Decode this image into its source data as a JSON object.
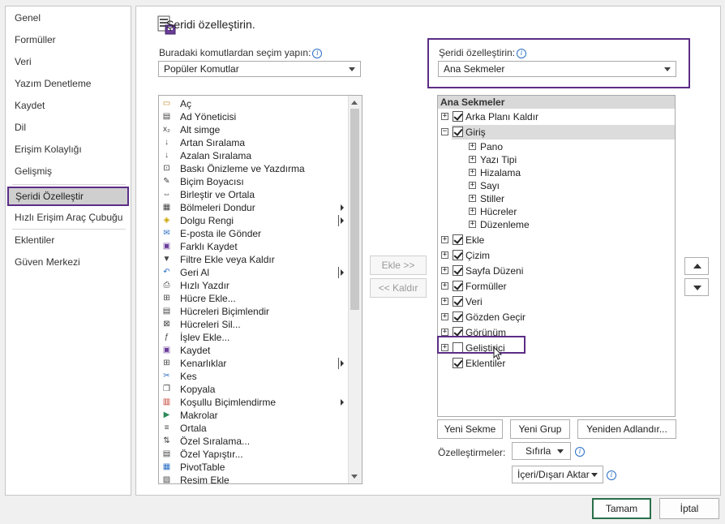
{
  "nav": {
    "items": [
      "Genel",
      "Formüller",
      "Veri",
      "Yazım Denetleme",
      "Kaydet",
      "Dil",
      "Erişim Kolaylığı",
      "Gelişmiş",
      "Şeridi Özelleştir",
      "Hızlı Erişim Araç Çubuğu",
      "Eklentiler",
      "Güven Merkezi"
    ],
    "selected": "Şeridi Özelleştir"
  },
  "header": {
    "title": "Şeridi özelleştirin."
  },
  "left_panel": {
    "label": "Buradaki komutlardan seçim yapın:",
    "dropdown_value": "Popüler Komutlar",
    "commands": [
      {
        "label": "Aç",
        "icon": "folder-icon",
        "submenu": false
      },
      {
        "label": "Ad Yöneticisi",
        "icon": "name-manager-icon",
        "submenu": false
      },
      {
        "label": "Alt simge",
        "icon": "subscript-icon",
        "submenu": false
      },
      {
        "label": "Artan Sıralama",
        "icon": "sort-ascending-icon",
        "submenu": false
      },
      {
        "label": "Azalan Sıralama",
        "icon": "sort-descending-icon",
        "submenu": false
      },
      {
        "label": "Baskı Önizleme ve Yazdırma",
        "icon": "print-preview-icon",
        "submenu": false
      },
      {
        "label": "Biçim Boyacısı",
        "icon": "format-painter-icon",
        "submenu": false
      },
      {
        "label": "Birleştir ve Ortala",
        "icon": "merge-center-icon",
        "submenu": false
      },
      {
        "label": "Bölmeleri Dondur",
        "icon": "freeze-panes-icon",
        "submenu": true,
        "separator": false
      },
      {
        "label": "Dolgu Rengi",
        "icon": "fill-color-icon",
        "submenu": true,
        "separator": true
      },
      {
        "label": "E-posta ile Gönder",
        "icon": "email-icon",
        "submenu": false
      },
      {
        "label": "Farklı Kaydet",
        "icon": "save-as-icon",
        "submenu": false
      },
      {
        "label": "Filtre Ekle veya Kaldır",
        "icon": "filter-icon",
        "submenu": false
      },
      {
        "label": "Geri Al",
        "icon": "undo-icon",
        "submenu": true,
        "separator": true
      },
      {
        "label": "Hızlı Yazdır",
        "icon": "quick-print-icon",
        "submenu": false
      },
      {
        "label": "Hücre Ekle...",
        "icon": "insert-cells-icon",
        "submenu": false
      },
      {
        "label": "Hücreleri Biçimlendir",
        "icon": "format-cells-icon",
        "submenu": false
      },
      {
        "label": "Hücreleri Sil...",
        "icon": "delete-cells-icon",
        "submenu": false
      },
      {
        "label": "İşlev Ekle...",
        "icon": "function-icon",
        "submenu": false
      },
      {
        "label": "Kaydet",
        "icon": "save-icon",
        "submenu": false
      },
      {
        "label": "Kenarlıklar",
        "icon": "borders-icon",
        "submenu": true,
        "separator": true
      },
      {
        "label": "Kes",
        "icon": "cut-icon",
        "submenu": false
      },
      {
        "label": "Kopyala",
        "icon": "copy-icon",
        "submenu": false
      },
      {
        "label": "Koşullu Biçimlendirme",
        "icon": "conditional-format-icon",
        "submenu": true,
        "separator": false
      },
      {
        "label": "Makrolar",
        "icon": "macros-icon",
        "submenu": false
      },
      {
        "label": "Ortala",
        "icon": "center-icon",
        "submenu": false
      },
      {
        "label": "Özel Sıralama...",
        "icon": "custom-sort-icon",
        "submenu": false
      },
      {
        "label": "Özel Yapıştır...",
        "icon": "paste-special-icon",
        "submenu": false
      },
      {
        "label": "PivotTable",
        "icon": "pivottable-icon",
        "submenu": false
      },
      {
        "label": "Resim Ekle",
        "icon": "insert-picture-icon",
        "submenu": false
      }
    ]
  },
  "middle": {
    "add_label": "Ekle >>",
    "remove_label": "<< Kaldır"
  },
  "right_panel": {
    "label": "Şeridi özelleştirin:",
    "dropdown_value": "Ana Sekmeler",
    "tree_header": "Ana Sekmeler",
    "tabs": [
      {
        "label": "Arka Planı Kaldır",
        "checked": true,
        "expanded": false
      },
      {
        "label": "Giriş",
        "checked": true,
        "expanded": true,
        "selected": true,
        "groups": [
          "Pano",
          "Yazı Tipi",
          "Hizalama",
          "Sayı",
          "Stiller",
          "Hücreler",
          "Düzenleme"
        ]
      },
      {
        "label": "Ekle",
        "checked": true,
        "expanded": false
      },
      {
        "label": "Çizim",
        "checked": true,
        "expanded": false
      },
      {
        "label": "Sayfa Düzeni",
        "checked": true,
        "expanded": false
      },
      {
        "label": "Formüller",
        "checked": true,
        "expanded": false
      },
      {
        "label": "Veri",
        "checked": true,
        "expanded": false
      },
      {
        "label": "Gözden Geçir",
        "checked": true,
        "expanded": false
      },
      {
        "label": "Görünüm",
        "checked": true,
        "expanded": false
      },
      {
        "label": "Geliştirici",
        "checked": false,
        "expanded": false,
        "highlighted": true
      },
      {
        "label": "Eklentiler",
        "checked": true,
        "expanded": false,
        "no_expander": true
      }
    ],
    "buttons": {
      "new_tab": "Yeni Sekme",
      "new_group": "Yeni Grup",
      "rename": "Yeniden Adlandır..."
    },
    "customizations_label": "Özelleştirmeler:",
    "reset_label": "Sıfırla",
    "import_export_label": "İçeri/Dışarı Aktar"
  },
  "footer": {
    "ok": "Tamam",
    "cancel": "İptal"
  },
  "colors": {
    "highlight": "#5c2d86",
    "selected_bg": "#cfcfcf",
    "ok_border": "#2a6f4a",
    "info": "#2a6fc4"
  }
}
